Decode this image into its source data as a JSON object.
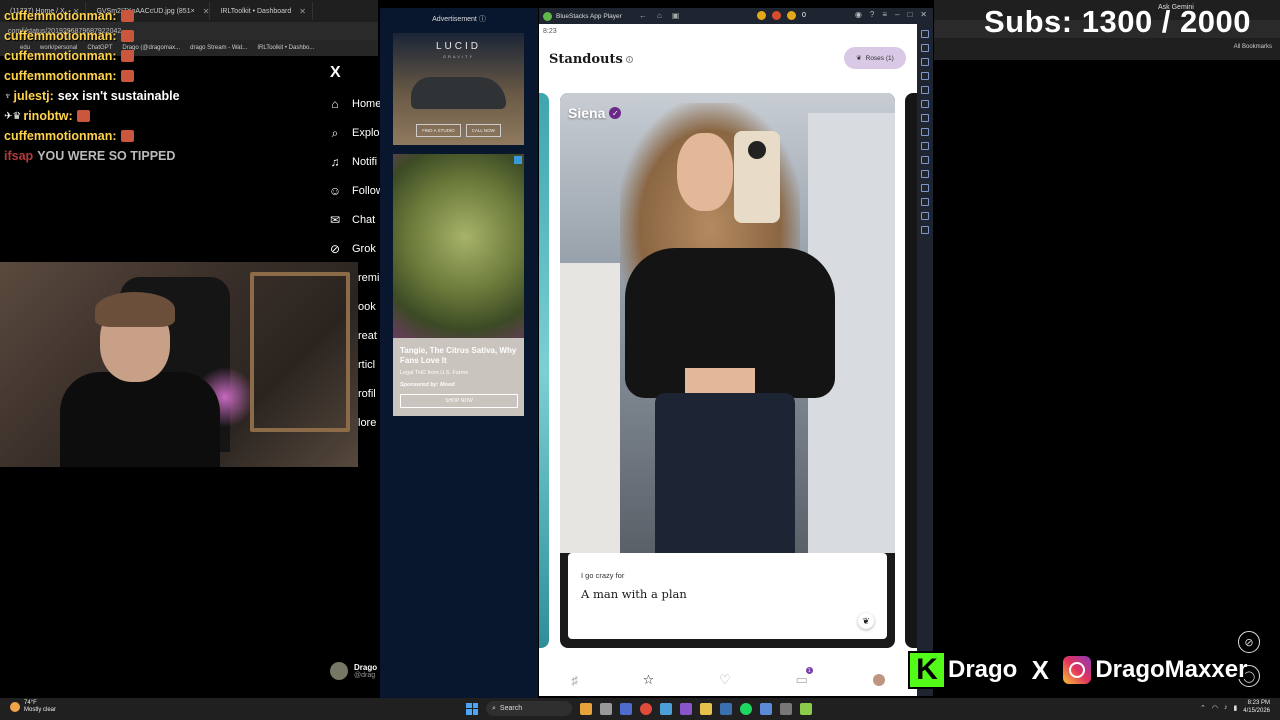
{
  "browser": {
    "tabs": [
      {
        "label": "(11737) Home / X"
      },
      {
        "label": "GVSm2I7XoAACcUD.jpg (851×"
      },
      {
        "label": "IRLToolkit • Dashboard"
      }
    ],
    "address": "com/i/status/2019296879687922042",
    "bookmarks": [
      "edu",
      "work/personal",
      "ChatGPT",
      "Drago (@dragomax...",
      "drago Stream - Wat...",
      "IRLToolkit • Dashbo..."
    ],
    "ask_label": "Ask Gemini",
    "all_bookmarks": "All Bookmarks"
  },
  "chat": [
    {
      "user": "cuffemmotionman:",
      "msg": "",
      "user_color": "#ffd34d"
    },
    {
      "user": "cuffemmotionman:",
      "msg": "",
      "user_color": "#ffd34d"
    },
    {
      "user": "cuffemmotionman:",
      "msg": "",
      "user_color": "#ffd34d"
    },
    {
      "user": "cuffemmotionman:",
      "msg": "",
      "user_color": "#ffd34d"
    },
    {
      "user": "julestj:",
      "msg": "sex isn't sustainable",
      "user_color": "#ffd34d"
    },
    {
      "user": "rinobtw:",
      "msg": "",
      "user_color": "#ffd34d"
    },
    {
      "user": "cuffemmotionman:",
      "msg": "",
      "user_color": "#ffd34d"
    },
    {
      "user": "ifsap",
      "msg": "YOU WERE SO TIPPED",
      "user_color": "#b23a3a"
    }
  ],
  "x_nav": {
    "logo": "X",
    "items": [
      {
        "label": "Home",
        "icon": "home-icon"
      },
      {
        "label": "Explo",
        "icon": "search-icon"
      },
      {
        "label": "Notifi",
        "icon": "bell-icon"
      },
      {
        "label": "Follow",
        "icon": "person-add-icon"
      },
      {
        "label": "Chat",
        "icon": "chat-icon"
      },
      {
        "label": "Grok",
        "icon": "grok-icon"
      },
      {
        "label": "remi",
        "icon": ""
      },
      {
        "label": "ook",
        "icon": ""
      },
      {
        "label": "reat",
        "icon": ""
      },
      {
        "label": "rticl",
        "icon": ""
      },
      {
        "label": "rofil",
        "icon": ""
      },
      {
        "label": "lore",
        "icon": ""
      }
    ],
    "profile_name": "Drago",
    "profile_handle": "@drag"
  },
  "ads": {
    "label": "Advertisement",
    "ad1_brand": "LUCID",
    "ad1_sub": "GRAVITY",
    "ad1_btn1": "FIND A STUDIO",
    "ad1_btn2": "CALL NOW",
    "ad2_title": "Tangie, The Citrus Sativa, Why Fans Love It",
    "ad2_desc": "Legal THC from U.S. Farms",
    "ad2_sponsored": "Sponsored by: Mood",
    "ad2_cta": "SHOP NOW"
  },
  "emulator": {
    "title": "BlueStacks App Player",
    "time": "8:23",
    "coins": "0"
  },
  "app": {
    "title": "Standouts",
    "roses_label": "Roses (1)",
    "profile_name": "Siena",
    "prompt_question": "I go crazy for",
    "prompt_answer": "A man with a plan",
    "nav_badge": "1"
  },
  "overlay": {
    "subs_text": "Subs: 1300 / 2000",
    "kick_name": "Drago",
    "ig_name": "DragoMaxxer"
  },
  "taskbar": {
    "temp": "74°F",
    "weather": "Mostly clear",
    "search": "Search",
    "time": "8:23 PM",
    "date": "4/15/2026"
  },
  "colors": {
    "accent_purple": "#6b2a8a",
    "roses_bg": "#d9c9e6",
    "ad_bg": "#08172e",
    "kick_green": "#53fc18"
  }
}
